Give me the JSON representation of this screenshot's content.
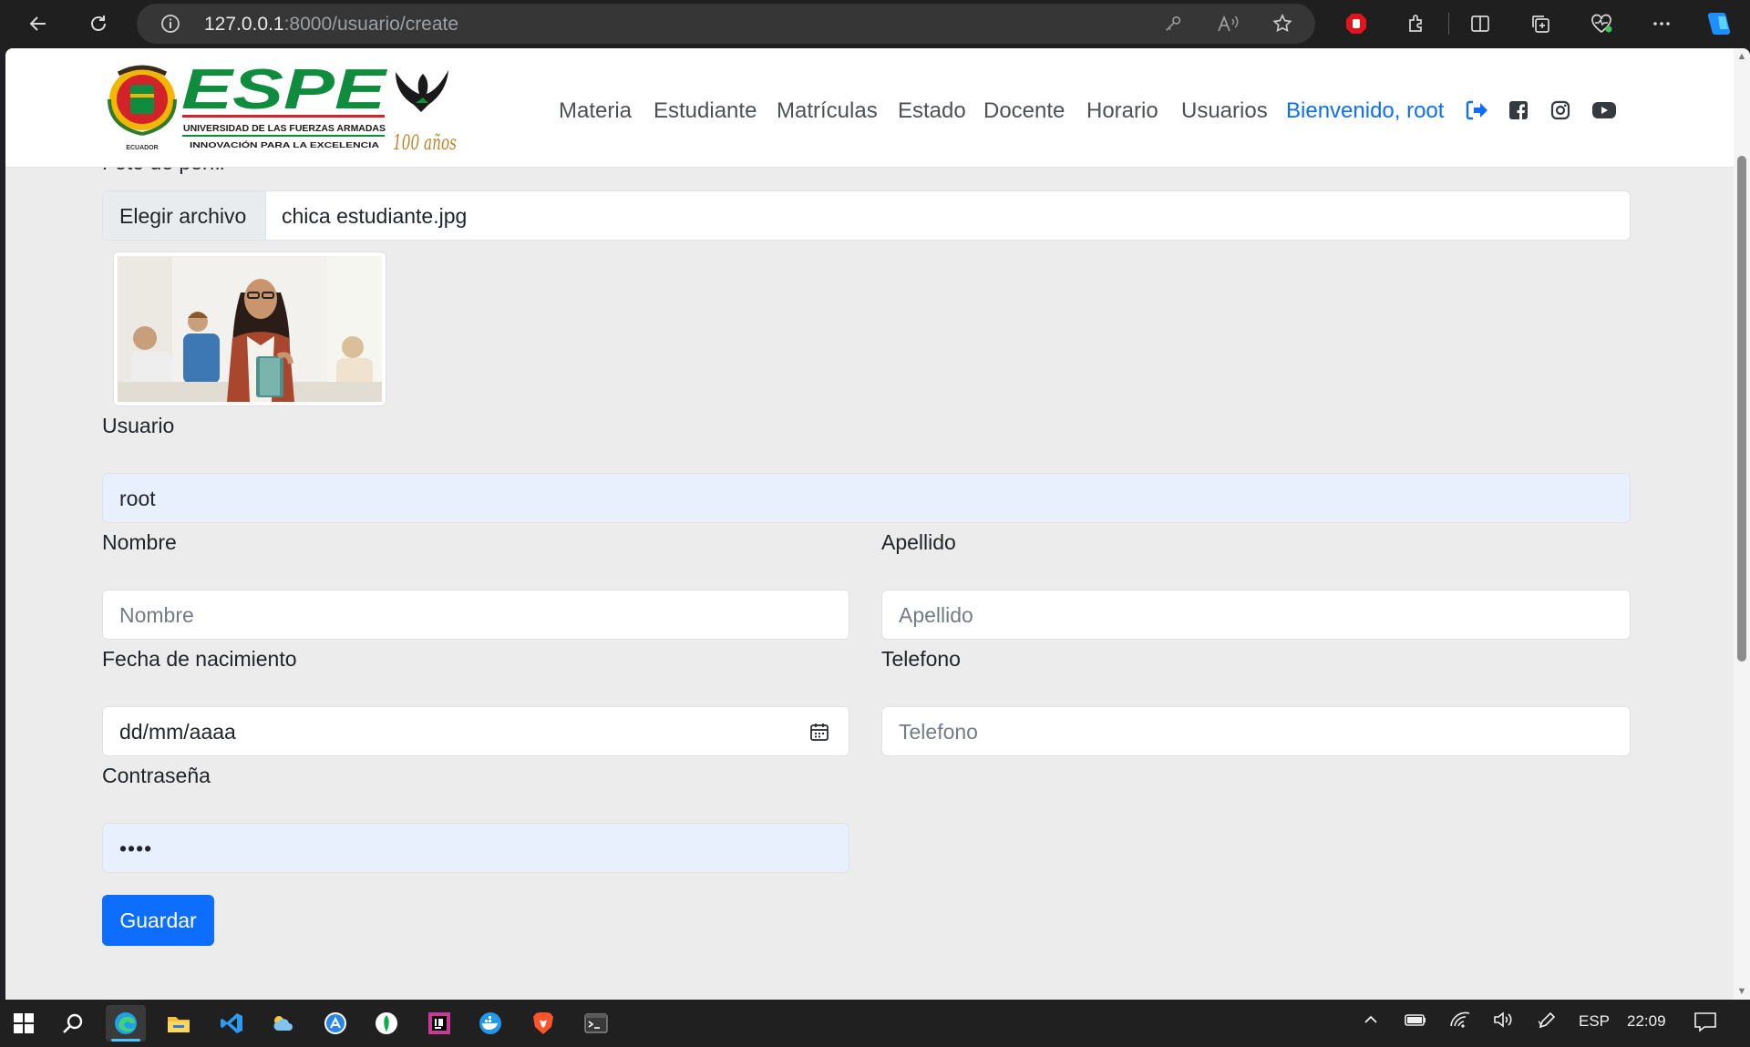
{
  "browser": {
    "url_host": "127.0.0.1",
    "url_path": ":8000/usuario/create"
  },
  "navbar": {
    "logo": {
      "wordmark": "ESPE",
      "university": "UNIVERSIDAD DE LAS FUERZAS ARMADAS",
      "motto": "INNOVACIÓN PARA LA EXCELENCIA",
      "crest_caption": "ECUADOR",
      "anniversary": "100 años"
    },
    "links": [
      "Materia",
      "Estudiante",
      "Matrículas",
      "Estado",
      "Docente",
      "Horario",
      "Usuarios"
    ],
    "welcome": "Bienvenido, root",
    "accent_color": "#0d6efd"
  },
  "form": {
    "photo": {
      "label": "Foto de perfil",
      "button": "Elegir archivo",
      "filename": "chica estudiante.jpg"
    },
    "usuario": {
      "label": "Usuario",
      "value": "root"
    },
    "nombre": {
      "label": "Nombre",
      "placeholder": "Nombre"
    },
    "apellido": {
      "label": "Apellido",
      "placeholder": "Apellido"
    },
    "fecha": {
      "label": "Fecha de nacimiento",
      "value": "dd/mm/aaaa"
    },
    "telefono": {
      "label": "Telefono",
      "placeholder": "Telefono"
    },
    "password": {
      "label": "Contraseña",
      "value": "••••"
    },
    "submit": "Guardar"
  },
  "taskbar": {
    "language": "ESP",
    "time": "22:09"
  }
}
